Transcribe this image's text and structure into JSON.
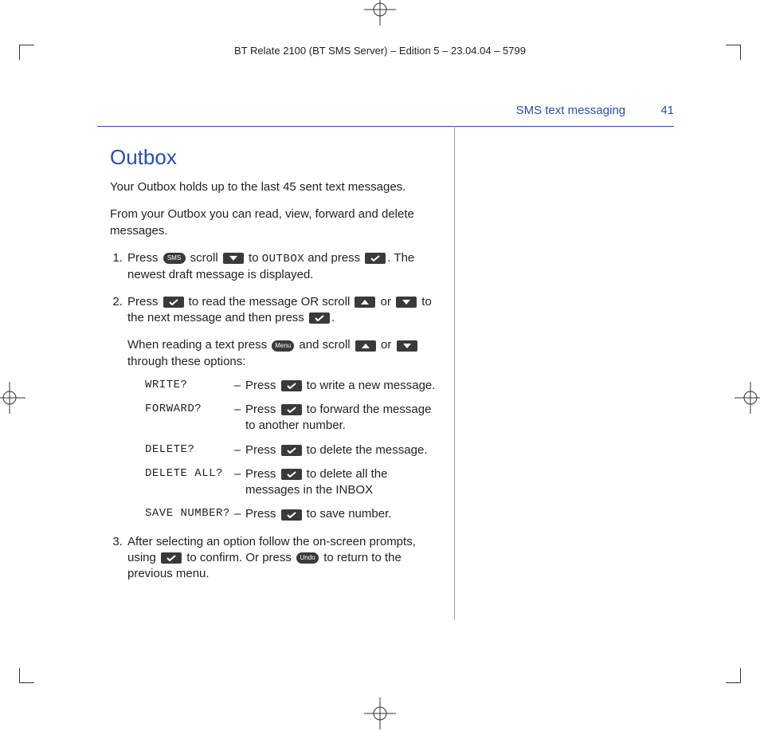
{
  "header": "BT Relate 2100 (BT SMS Server) – Edition 5 – 23.04.04 – 5799",
  "running_head": {
    "section": "SMS text messaging",
    "page": "41"
  },
  "title": "Outbox",
  "intro1": "Your Outbox holds up to the last 45 sent text messages.",
  "intro2": "From your Outbox you can read, view, forward and delete messages.",
  "step1_a": "Press ",
  "step1_b": " scroll ",
  "step1_c": " to ",
  "step1_lcd": "OUTBOX",
  "step1_d": " and press ",
  "step1_e": ". The newest draft message is displayed.",
  "step2_a": "Press ",
  "step2_b": " to read the message OR scroll ",
  "step2_c": " or ",
  "step2_d": " to the next message and then press ",
  "step2_e": ".",
  "step2x_a": "When reading a text press ",
  "step2x_b": " and scroll ",
  "step2x_c": " or ",
  "step2x_d": " through these options:",
  "opts": [
    {
      "label": "WRITE?",
      "pre": "Press ",
      "post": " to write a new message."
    },
    {
      "label": "FORWARD?",
      "pre": "Press ",
      "post": " to forward the message to another number."
    },
    {
      "label": "DELETE?",
      "pre": "Press ",
      "post": " to delete the message."
    },
    {
      "label": "DELETE ALL?",
      "pre": "Press ",
      "post": " to delete all the messages in the INBOX"
    },
    {
      "label": "SAVE NUMBER?",
      "pre": "Press ",
      "post": " to save number."
    }
  ],
  "step3_a": "After selecting an option follow the on-screen prompts, using ",
  "step3_b": " to confirm. Or press ",
  "step3_c": " to return to the previous menu.",
  "keys": {
    "sms": "SMS",
    "menu": "Menu",
    "undo": "Undo"
  }
}
